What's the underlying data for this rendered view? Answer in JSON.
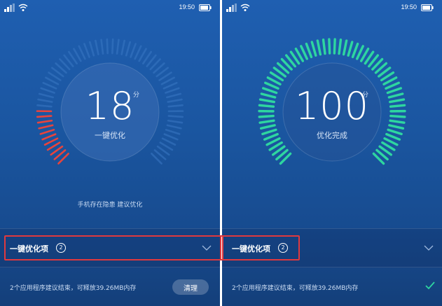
{
  "status_bar": {
    "time": "19:50"
  },
  "colors": {
    "background": "#1a559f",
    "gauge_low": "#e8443c",
    "gauge_done": "#2ed6a0",
    "gauge_inactive": "#3a78c4",
    "highlight": "#e0393e",
    "checkmark": "#2ed6a0"
  },
  "left_screen": {
    "score": "18",
    "score_unit": "分",
    "action_label": "一键优化",
    "hint": "手机存在隐患  建议优化",
    "gauge_progress": 0.18,
    "section": {
      "title": "一键优化项",
      "count": "2"
    },
    "item_text": "2个应用程序建议结束，可释放39.26MB内存",
    "clean_button": "清理"
  },
  "right_screen": {
    "score": "100",
    "score_unit": "分",
    "status_label": "优化完成",
    "gauge_progress": 1.0,
    "section": {
      "title": "一键优化项",
      "count": "2"
    },
    "item_text": "2个应用程序建议结束，可释放39.26MB内存"
  },
  "icons": {
    "signal": "signal-icon",
    "wifi": "wifi-icon",
    "battery": "battery-icon",
    "expand": "chevron-down-icon",
    "done": "checkmark-icon"
  }
}
